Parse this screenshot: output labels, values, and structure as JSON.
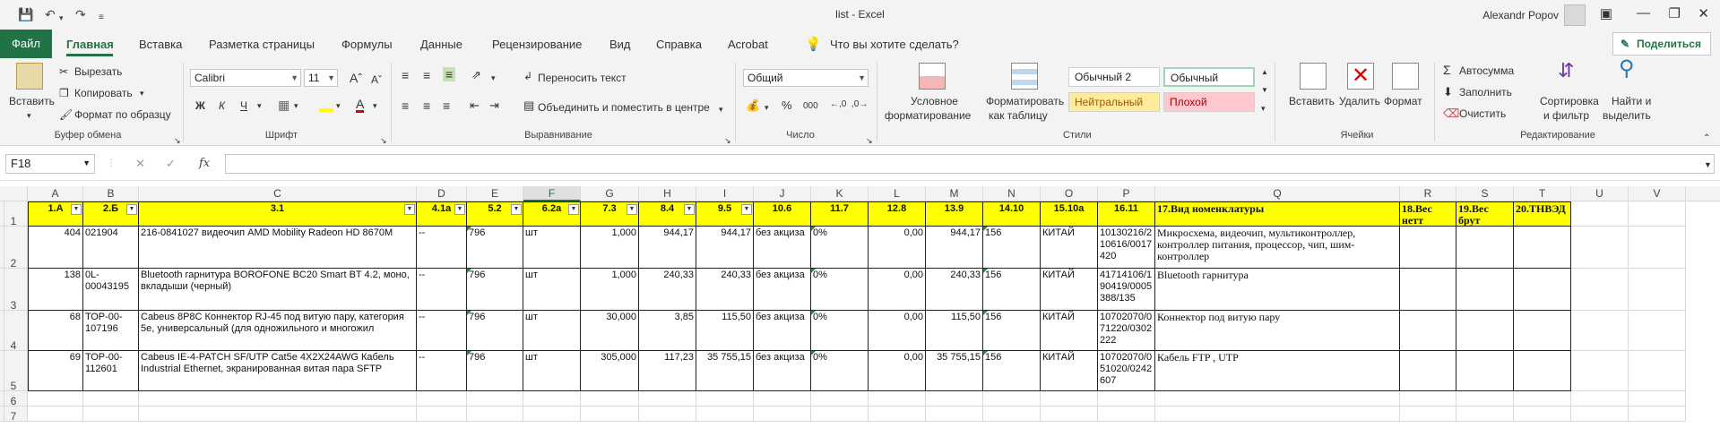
{
  "window": {
    "title": "list - Excel",
    "user": "Alexandr Popov"
  },
  "tabs": [
    "Файл",
    "Главная",
    "Вставка",
    "Разметка страницы",
    "Формулы",
    "Данные",
    "Рецензирование",
    "Вид",
    "Справка",
    "Acrobat"
  ],
  "tell_me": "Что вы хотите сделать?",
  "share": "Поделиться",
  "ribbon": {
    "paste": "Вставить",
    "cut": "Вырезать",
    "copy": "Копировать",
    "format_painter": "Формат по образцу",
    "clipboard": "Буфер обмена",
    "font_name": "Calibri",
    "font_size": "11",
    "bold": "Ж",
    "italic": "К",
    "underline": "Ч",
    "font": "Шрифт",
    "wrap": "Переносить текст",
    "merge": "Объединить и поместить в центре",
    "alignment": "Выравнивание",
    "num_format": "Общий",
    "percent": "%",
    "thousands": "000",
    "number": "Число",
    "cond_format_1": "Условное",
    "cond_format_2": "форматирование",
    "format_table_1": "Форматировать",
    "format_table_2": "как таблицу",
    "style_normal2": "Обычный 2",
    "style_normal": "Обычный",
    "style_neutral": "Нейтральный",
    "style_bad": "Плохой",
    "styles": "Стили",
    "insert": "Вставить",
    "delete": "Удалить",
    "format": "Формат",
    "cells": "Ячейки",
    "autosum": "Автосумма",
    "fill": "Заполнить",
    "clear": "Очистить",
    "sort_1": "Сортировка",
    "sort_2": "и фильтр",
    "find_1": "Найти и",
    "find_2": "выделить",
    "editing": "Редактирование"
  },
  "namebox": "F18",
  "formula": "",
  "columns": [
    "A",
    "B",
    "C",
    "D",
    "E",
    "F",
    "G",
    "H",
    "I",
    "J",
    "K",
    "L",
    "M",
    "N",
    "O",
    "P",
    "Q",
    "R",
    "S",
    "T",
    "U",
    "V",
    "W"
  ],
  "selected_column": "F",
  "row_numbers": [
    "1",
    "2",
    "3",
    "4",
    "5",
    "6",
    "7"
  ],
  "headers": [
    "1.А",
    "2.Б",
    "3.1",
    "4.1а",
    "5.2",
    "6.2а",
    "7.3",
    "8.4",
    "9.5",
    "10.6",
    "11.7",
    "12.8",
    "13.9",
    "14.10",
    "15.10а",
    "16.11",
    "17.Вид номенклатуры",
    "18.Вес нетт",
    "19.Вес брут",
    "20.ТНВЭД"
  ],
  "rows": [
    [
      "404",
      "021904",
      "216-0841027 видеочип AMD Mobility Radeon HD 8670M",
      "--",
      "796",
      "шт",
      "1,000",
      "944,17",
      "944,17",
      "без акциза",
      "0%",
      "0,00",
      "944,17",
      "156",
      "КИТАЙ",
      "10130216/2 10616/0017 420",
      "Микросхема, видеочип, мультиконтроллер, контроллер питания, процессор, чип, шим-контроллер",
      "",
      "",
      ""
    ],
    [
      "138",
      "0L-00043195",
      "Bluetooth гарнитура BOROFONE BC20 Smart BT 4.2, моно, вкладыши (черный)",
      "--",
      "796",
      "шт",
      "1,000",
      "240,33",
      "240,33",
      "без акциза",
      "0%",
      "0,00",
      "240,33",
      "156",
      "КИТАЙ",
      "41714106/1 90419/0005 388/135",
      "Bluetooth гарнитура",
      "",
      "",
      ""
    ],
    [
      "68",
      "ТОР-00-107196",
      "Cabeus 8P8C Коннектор RJ-45 под витую пару, категория 5e, универсальный (для одножильного и многожил",
      "--",
      "796",
      "шт",
      "30,000",
      "3,85",
      "115,50",
      "без акциза",
      "0%",
      "0,00",
      "115,50",
      "156",
      "КИТАЙ",
      "10702070/0 71220/0302 222",
      "Коннектор под витую пару",
      "",
      "",
      ""
    ],
    [
      "69",
      "ТОР-00-112601",
      "Cabeus IE-4-PATCH SF/UTP Cat5e 4X2X24AWG Кабель Industrial Ethernet, экранированная витая пара SFTP",
      "--",
      "796",
      "шт",
      "305,000",
      "117,23",
      "35 755,15",
      "без акциза",
      "0%",
      "0,00",
      "35 755,15",
      "156",
      "КИТАЙ",
      "10702070/0 51020/0242 607",
      "Кабель FTP , UTP",
      "",
      "",
      ""
    ]
  ]
}
